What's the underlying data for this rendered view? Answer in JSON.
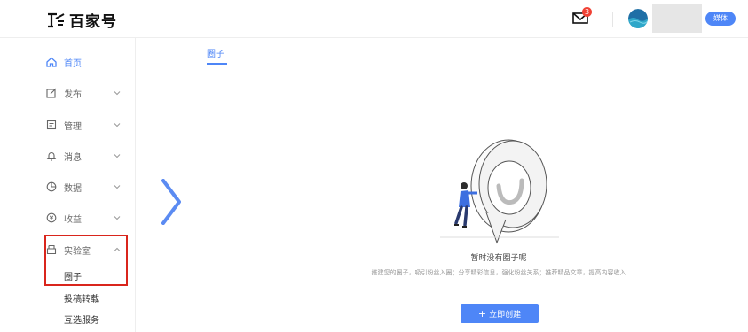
{
  "header": {
    "logo_text": "百家号",
    "notification_count": "3",
    "role_badge": "媒体"
  },
  "sidebar": {
    "items": [
      {
        "label": "首页",
        "icon": "home-icon",
        "active": true
      },
      {
        "label": "发布",
        "icon": "edit-icon"
      },
      {
        "label": "管理",
        "icon": "list-icon"
      },
      {
        "label": "消息",
        "icon": "bell-icon"
      },
      {
        "label": "数据",
        "icon": "pie-chart-icon"
      },
      {
        "label": "收益",
        "icon": "money-icon"
      },
      {
        "label": "实验室",
        "icon": "lab-icon",
        "expanded": true
      }
    ],
    "lab_sub_items": [
      "圈子",
      "投稿转载",
      "互选服务"
    ]
  },
  "main": {
    "tab_label": "圈子",
    "empty_title": "暂时没有圈子呢",
    "empty_desc": "搭建您的圈子，吸引粉丝入圈；分享精彩信息，强化粉丝关系；推荐精品文章，提高内容收入",
    "create_button": "立即创建"
  },
  "colors": {
    "accent": "#4e86f7",
    "highlight_border": "#d9251c"
  }
}
